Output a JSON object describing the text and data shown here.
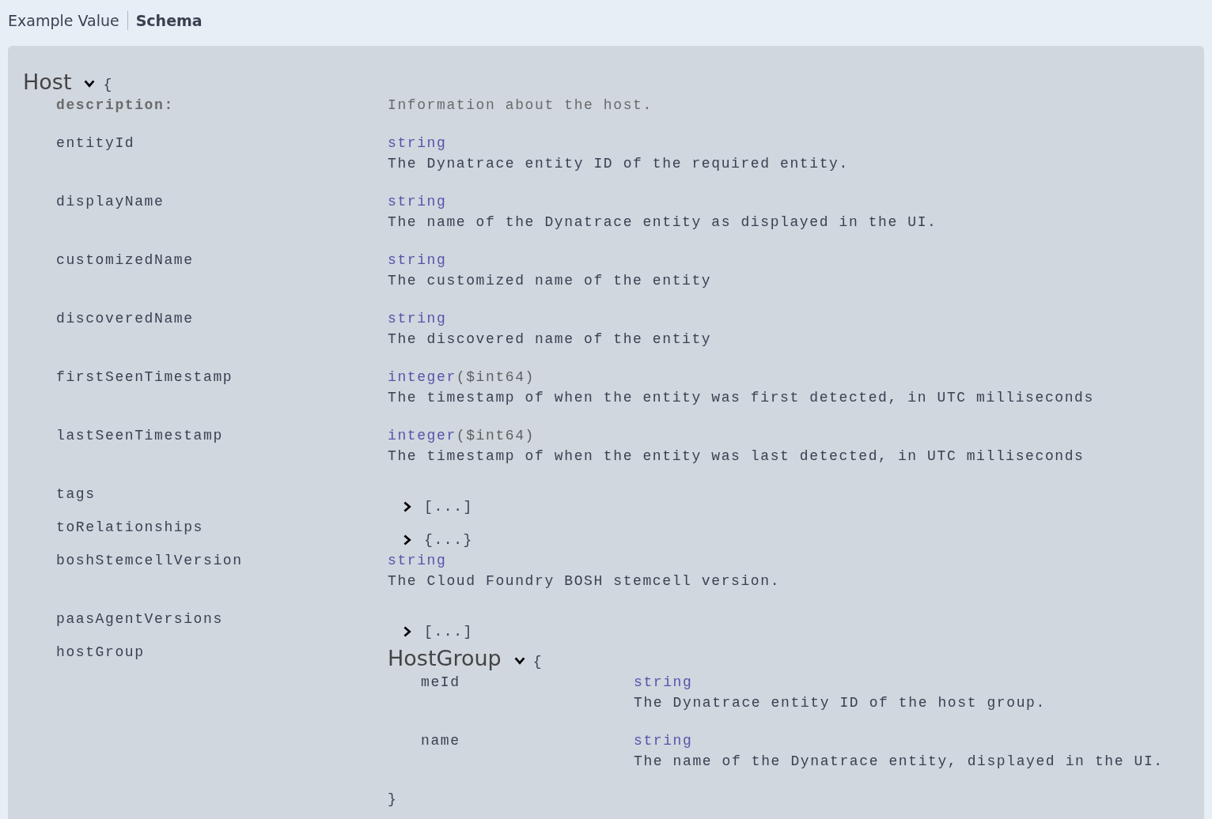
{
  "tabs": [
    {
      "label": "Example Value",
      "selected": false
    },
    {
      "label": "Schema",
      "selected": true
    }
  ],
  "model": {
    "title": "Host",
    "expanded": true,
    "open_brace": "{",
    "description_label": "description:",
    "description": "Information about the host.",
    "properties": [
      {
        "name": "entityId",
        "kind": "primitive",
        "type": "string",
        "description": "The Dynatrace entity ID of the required entity."
      },
      {
        "name": "displayName",
        "kind": "primitive",
        "type": "string",
        "description": "The name of the Dynatrace entity as displayed in the UI."
      },
      {
        "name": "customizedName",
        "kind": "primitive",
        "type": "string",
        "description": "The customized name of the entity"
      },
      {
        "name": "discoveredName",
        "kind": "primitive",
        "type": "string",
        "description": "The discovered name of the entity"
      },
      {
        "name": "firstSeenTimestamp",
        "kind": "primitive",
        "type": "integer",
        "format": "($int64)",
        "description": "The timestamp of when the entity was first detected, in UTC milliseconds"
      },
      {
        "name": "lastSeenTimestamp",
        "kind": "primitive",
        "type": "integer",
        "format": "($int64)",
        "description": "The timestamp of when the entity was last detected, in UTC milliseconds"
      },
      {
        "name": "tags",
        "kind": "collapsed",
        "expanded": false,
        "preview": "[...]"
      },
      {
        "name": "toRelationships",
        "kind": "collapsed",
        "expanded": false,
        "preview": "{...}"
      },
      {
        "name": "boshStemcellVersion",
        "kind": "primitive",
        "type": "string",
        "description": "The Cloud Foundry BOSH stemcell version."
      },
      {
        "name": "paasAgentVersions",
        "kind": "collapsed",
        "expanded": false,
        "preview": "[...]"
      },
      {
        "name": "hostGroup",
        "kind": "model",
        "title": "HostGroup",
        "expanded": true,
        "open_brace": "{",
        "close_brace": "}",
        "properties": [
          {
            "name": "meId",
            "kind": "primitive",
            "type": "string",
            "description": "The Dynatrace entity ID of the host group."
          },
          {
            "name": "name",
            "kind": "primitive",
            "type": "string",
            "description": "The name of the Dynatrace entity, displayed in the UI."
          }
        ]
      }
    ]
  }
}
